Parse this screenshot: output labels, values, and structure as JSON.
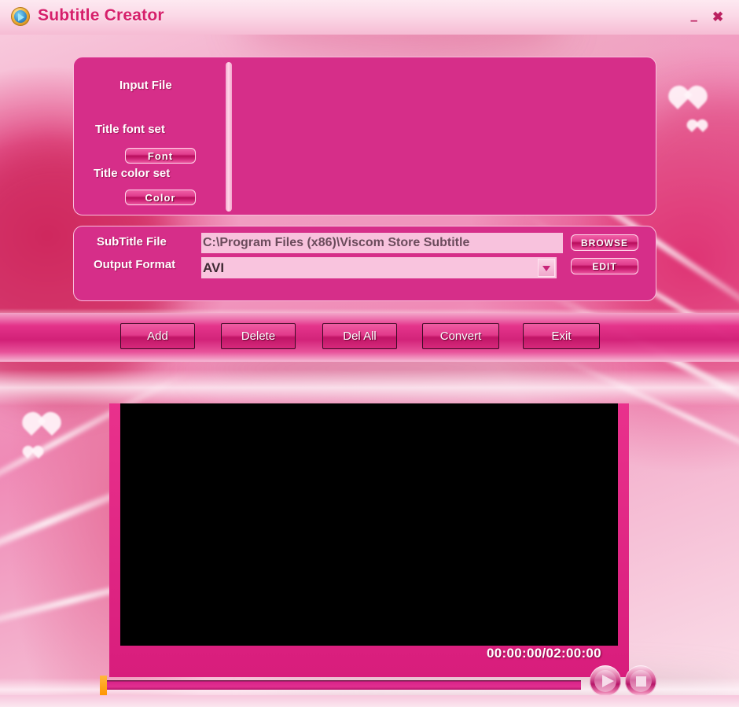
{
  "window": {
    "title": "Subtitle Creator",
    "icon": "play-disc-icon",
    "minimize_label": "–",
    "close_label": "✖"
  },
  "top_panel": {
    "input_file_label": "Input File",
    "title_font_label": "Title font set",
    "font_button_label": "Font",
    "title_color_label": "Title color set",
    "color_button_label": "Color"
  },
  "file_panel": {
    "subtitle_file_label": "SubTitle File",
    "subtitle_file_value": "C:\\Program Files (x86)\\Viscom Store Subtitle",
    "output_format_label": "Output Format",
    "output_format_value": "AVI",
    "browse_button_label": "BROWSE",
    "edit_button_label": "EDIT"
  },
  "actions": {
    "add_label": "Add",
    "delete_label": "Delete",
    "del_all_label": "Del All",
    "convert_label": "Convert",
    "exit_label": "Exit"
  },
  "player": {
    "time_display": "00:00:00/02:00:00",
    "play_icon": "play-icon",
    "stop_icon": "stop-icon",
    "seek_position_percent": 0
  },
  "colors": {
    "panel": "#d62e89",
    "panel_border": "#f9bedb",
    "title_text": "#d61f6b",
    "field_bg": "#f8c2dd",
    "accent_orange": "#ff9500",
    "video_bg": "#000000"
  }
}
